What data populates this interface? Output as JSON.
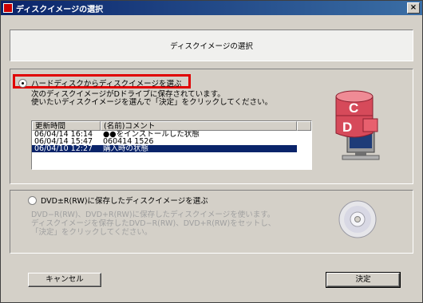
{
  "window": {
    "title": "ディスクイメージの選択",
    "close_label": "×"
  },
  "header": {
    "title": "ディスクイメージの選択"
  },
  "option_hdd": {
    "label": "ハードディスクからディスクイメージを選ぶ",
    "desc_line1": "次のディスクイメージがDドライブに保存されています。",
    "desc_line2": "使いたいディスクイメージを選んで「決定」をクリックしてください。",
    "table": {
      "columns": [
        "更新時間",
        "(名前)コメント"
      ],
      "rows": [
        {
          "time": "06/04/14 16:14",
          "comment": "●●をインストールした状態",
          "selected": false
        },
        {
          "time": "06/04/14 15:47",
          "comment": "060414 1526",
          "selected": false
        },
        {
          "time": "06/04/10 12:27",
          "comment": "購入時の状態",
          "selected": true
        }
      ]
    },
    "icon_drive_c": "C",
    "icon_drive_d": "D"
  },
  "option_dvd": {
    "label": "DVD±R(RW)に保存したディスクイメージを選ぶ",
    "desc_line1": "DVD−R(RW)、DVD+R(RW)に保存したディスクイメージを使います。",
    "desc_line2": "ディスクイメージを保存したDVD−R(RW)、DVD+R(RW)をセットし、",
    "desc_line3": "「決定」をクリックしてください。"
  },
  "buttons": {
    "cancel": "キャンセル",
    "ok": "決定"
  },
  "colors": {
    "highlight": "#e00000",
    "selection": "#0a246a",
    "drive_icon": "#d64a5a"
  }
}
